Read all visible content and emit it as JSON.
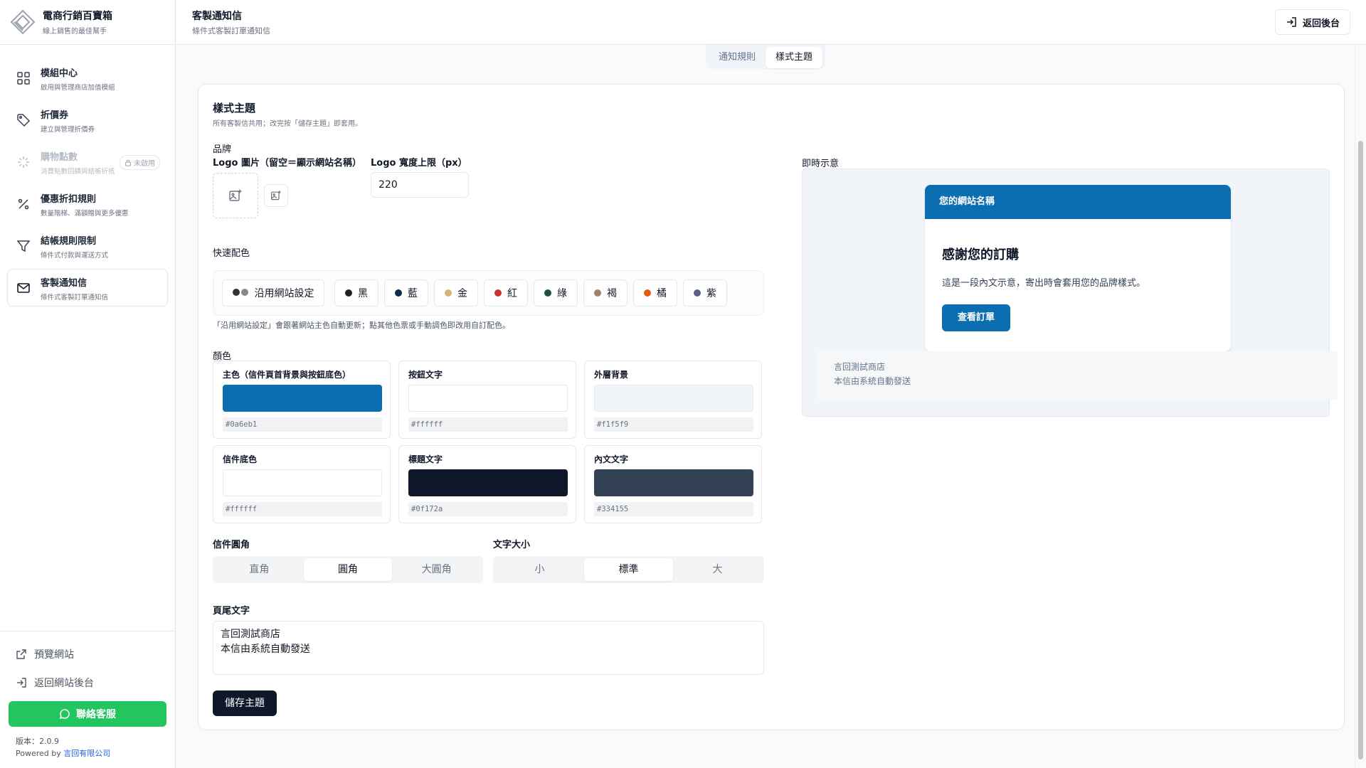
{
  "app": {
    "title": "電商行銷百寶箱",
    "subtitle": "線上銷售的最佳幫手"
  },
  "sidebar": {
    "items": [
      {
        "label": "模組中心",
        "sub": "啟用與管理商店加值模組",
        "icon": "grid-icon"
      },
      {
        "label": "折價券",
        "sub": "建立與管理折價券",
        "icon": "tag-icon"
      },
      {
        "label": "購物點數",
        "sub": "消費點數回饋與結帳折抵",
        "icon": "sparkle-icon",
        "badge": "未啟用"
      },
      {
        "label": "優惠折扣規則",
        "sub": "數量階梯、滿額贈與更多優惠",
        "icon": "percent-icon"
      },
      {
        "label": "結帳規則限制",
        "sub": "條件式付款與運送方式",
        "icon": "filter-icon"
      },
      {
        "label": "客製通知信",
        "sub": "條件式客製訂單通知信",
        "icon": "mail-icon"
      }
    ],
    "preview_site": "預覽網站",
    "back_site": "返回網站後台",
    "support": "聯絡客服",
    "version": "版本：2.0.9",
    "powered_by": "Powered by",
    "company": "言回有限公司"
  },
  "header": {
    "title": "客製通知信",
    "subtitle": "條件式客製訂單通知信",
    "back": "返回後台"
  },
  "tabs": [
    "通知規則",
    "樣式主題"
  ],
  "theme": {
    "title": "樣式主題",
    "desc": "所有客製信共用；改完按「儲存主題」即套用。",
    "brand_label": "品牌",
    "logo_label": "Logo 圖片（留空＝顯示網站名稱）",
    "logo_width_label": "Logo 寬度上限（px）",
    "logo_width": "220",
    "preset_label": "快速配色",
    "presets": [
      {
        "label": "沿用網站設定",
        "colors": [
          "#333333",
          "#888888"
        ]
      },
      {
        "label": "黑",
        "colors": [
          "#222222"
        ]
      },
      {
        "label": "藍",
        "colors": [
          "#0f2a4a"
        ]
      },
      {
        "label": "金",
        "colors": [
          "#d6b370"
        ]
      },
      {
        "label": "紅",
        "colors": [
          "#d0312d"
        ]
      },
      {
        "label": "綠",
        "colors": [
          "#1f5040"
        ]
      },
      {
        "label": "褐",
        "colors": [
          "#a0816a"
        ]
      },
      {
        "label": "橘",
        "colors": [
          "#e8590c"
        ]
      },
      {
        "label": "紫",
        "colors": [
          "#5a5e8c"
        ]
      }
    ],
    "preset_note": "「沿用網站設定」會跟著網站主色自動更新；點其他色票或手動調色即改用自訂配色。",
    "color_label": "顏色",
    "colors": [
      {
        "label": "主色（信件頁首背景與按鈕底色）",
        "hex": "#0a6eb1"
      },
      {
        "label": "按鈕文字",
        "hex": "#ffffff"
      },
      {
        "label": "外層背景",
        "hex": "#f1f5f9"
      },
      {
        "label": "信件底色",
        "hex": "#ffffff"
      },
      {
        "label": "標題文字",
        "hex": "#0f172a"
      },
      {
        "label": "內文文字",
        "hex": "#334155"
      }
    ],
    "radius_label": "信件圓角",
    "radius_options": [
      "直角",
      "圓角",
      "大圓角"
    ],
    "radius_selected": "圓角",
    "font_size_label": "文字大小",
    "font_size_options": [
      "小",
      "標準",
      "大"
    ],
    "font_size_selected": "標準",
    "footer_label": "頁尾文字",
    "footer_text": "言回測試商店\n本信由系統自動發送",
    "save": "儲存主題"
  },
  "preview": {
    "label": "即時示意",
    "site_name": "您的網站名稱",
    "heading": "感謝您的訂購",
    "body": "這是一段內文示意，寄出時會套用您的品牌樣式。",
    "button": "查看訂單",
    "footer": "言回測試商店\n本信由系統自動發送"
  }
}
